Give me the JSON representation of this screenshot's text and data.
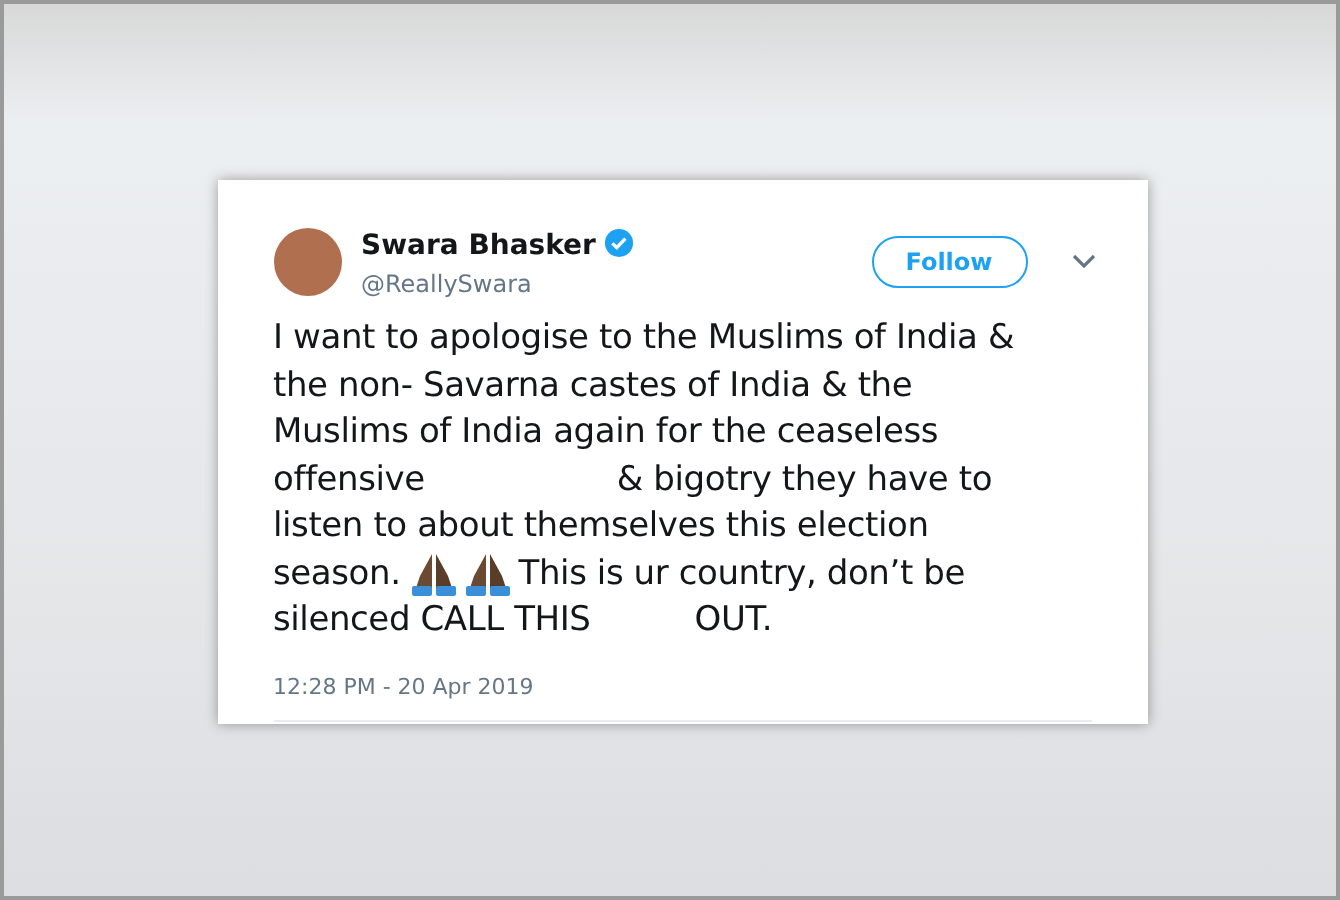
{
  "tweet": {
    "author": {
      "name": "Swara Bhasker",
      "handle": "@ReallySwara",
      "verified": true
    },
    "follow_button": "Follow",
    "body_lines": [
      [
        {
          "kind": "text",
          "text": "I want to apologise to the Muslims of India &"
        }
      ],
      [
        {
          "kind": "text",
          "text": "the non- Savarna castes of India & the"
        }
      ],
      [
        {
          "kind": "text",
          "text": "Muslims of India again for the ceaseless"
        }
      ],
      [
        {
          "kind": "text",
          "text": "offensive"
        },
        {
          "kind": "gap"
        },
        {
          "kind": "text",
          "text": "& bigotry they have to"
        }
      ],
      [
        {
          "kind": "text",
          "text": "listen to about themselves this election"
        }
      ],
      [
        {
          "kind": "text",
          "text": "season."
        },
        {
          "kind": "emoji"
        },
        {
          "kind": "emoji"
        },
        {
          "kind": "text",
          "text": "This is ur country, don’t be"
        }
      ],
      [
        {
          "kind": "text",
          "text": "silenced CALL THIS"
        },
        {
          "kind": "short_gap"
        },
        {
          "kind": "text",
          "text": "OUT."
        }
      ]
    ],
    "timestamp": "12:28 PM - 20 Apr 2019"
  }
}
